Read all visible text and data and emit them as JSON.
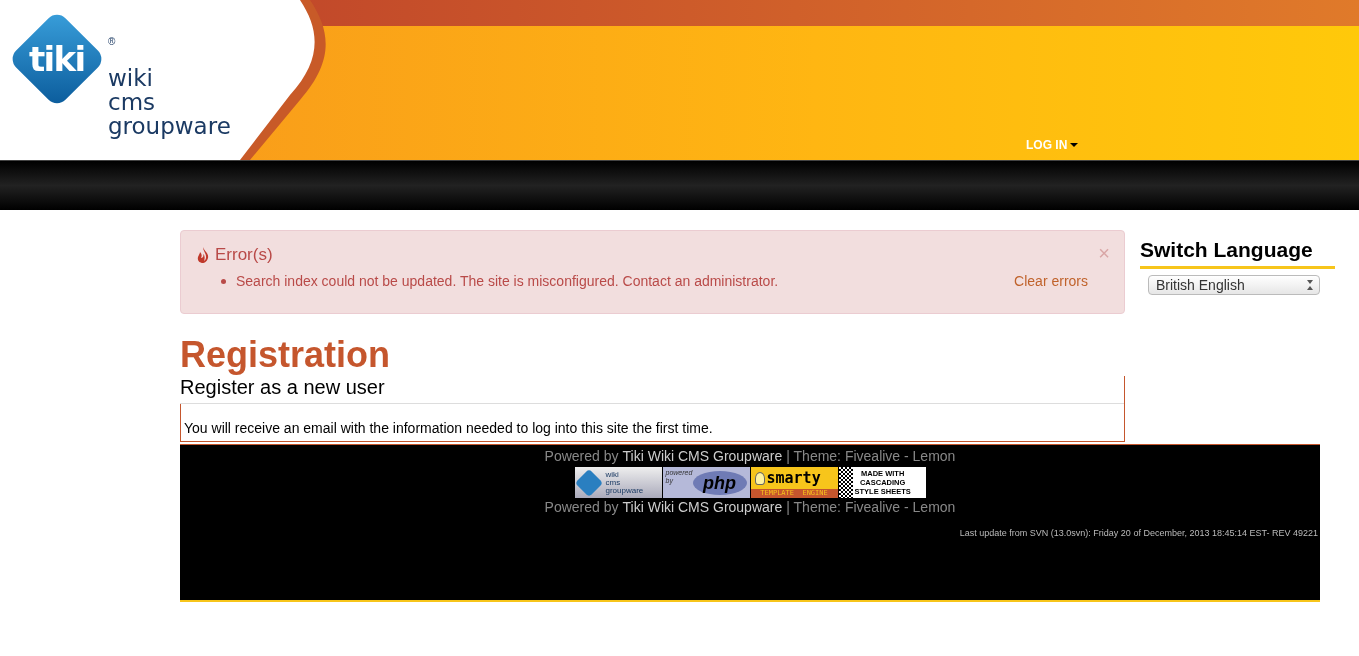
{
  "header": {
    "logo": {
      "mark": "tiki",
      "registered": "®",
      "lines": [
        "wiki",
        "cms",
        "groupware"
      ]
    },
    "login": {
      "label": "LOG IN"
    }
  },
  "alert": {
    "title": "Error(s)",
    "messages": [
      "Search index could not be updated. The site is misconfigured. Contact an administrator."
    ],
    "action": "Clear errors",
    "close": "×"
  },
  "page": {
    "title": "Registration",
    "subtitle": "Register as a new user",
    "text": "You will receive an email with the information needed to log into this site the first time."
  },
  "sidebar": {
    "title": "Switch Language",
    "language": "British English"
  },
  "footer": {
    "powered": [
      {
        "prefix": "Powered by",
        "link": "Tiki Wiki CMS Groupware",
        "suffix": "| Theme: Fivealive - Lemon"
      }
    ],
    "badges": [
      {
        "kind": "tiki",
        "lines": [
          "wiki",
          "cms",
          "groupware"
        ]
      },
      {
        "kind": "php",
        "lines": [
          "powered",
          "by",
          "php"
        ]
      },
      {
        "kind": "smarty",
        "lines": [
          "smarty",
          "TEMPLATE  ENGINE"
        ]
      },
      {
        "kind": "css",
        "lines": [
          "MADE WITH",
          "CASCADING",
          "STYLE SHEETS"
        ]
      }
    ],
    "powered2": {
      "prefix": "Powered by",
      "link": "Tiki Wiki CMS Groupware",
      "suffix": "| Theme: Fivealive - Lemon"
    },
    "update": "Last update from SVN (13.0svn): Friday 20 of December, 2013 18:45:14 EST- REV 49221"
  }
}
